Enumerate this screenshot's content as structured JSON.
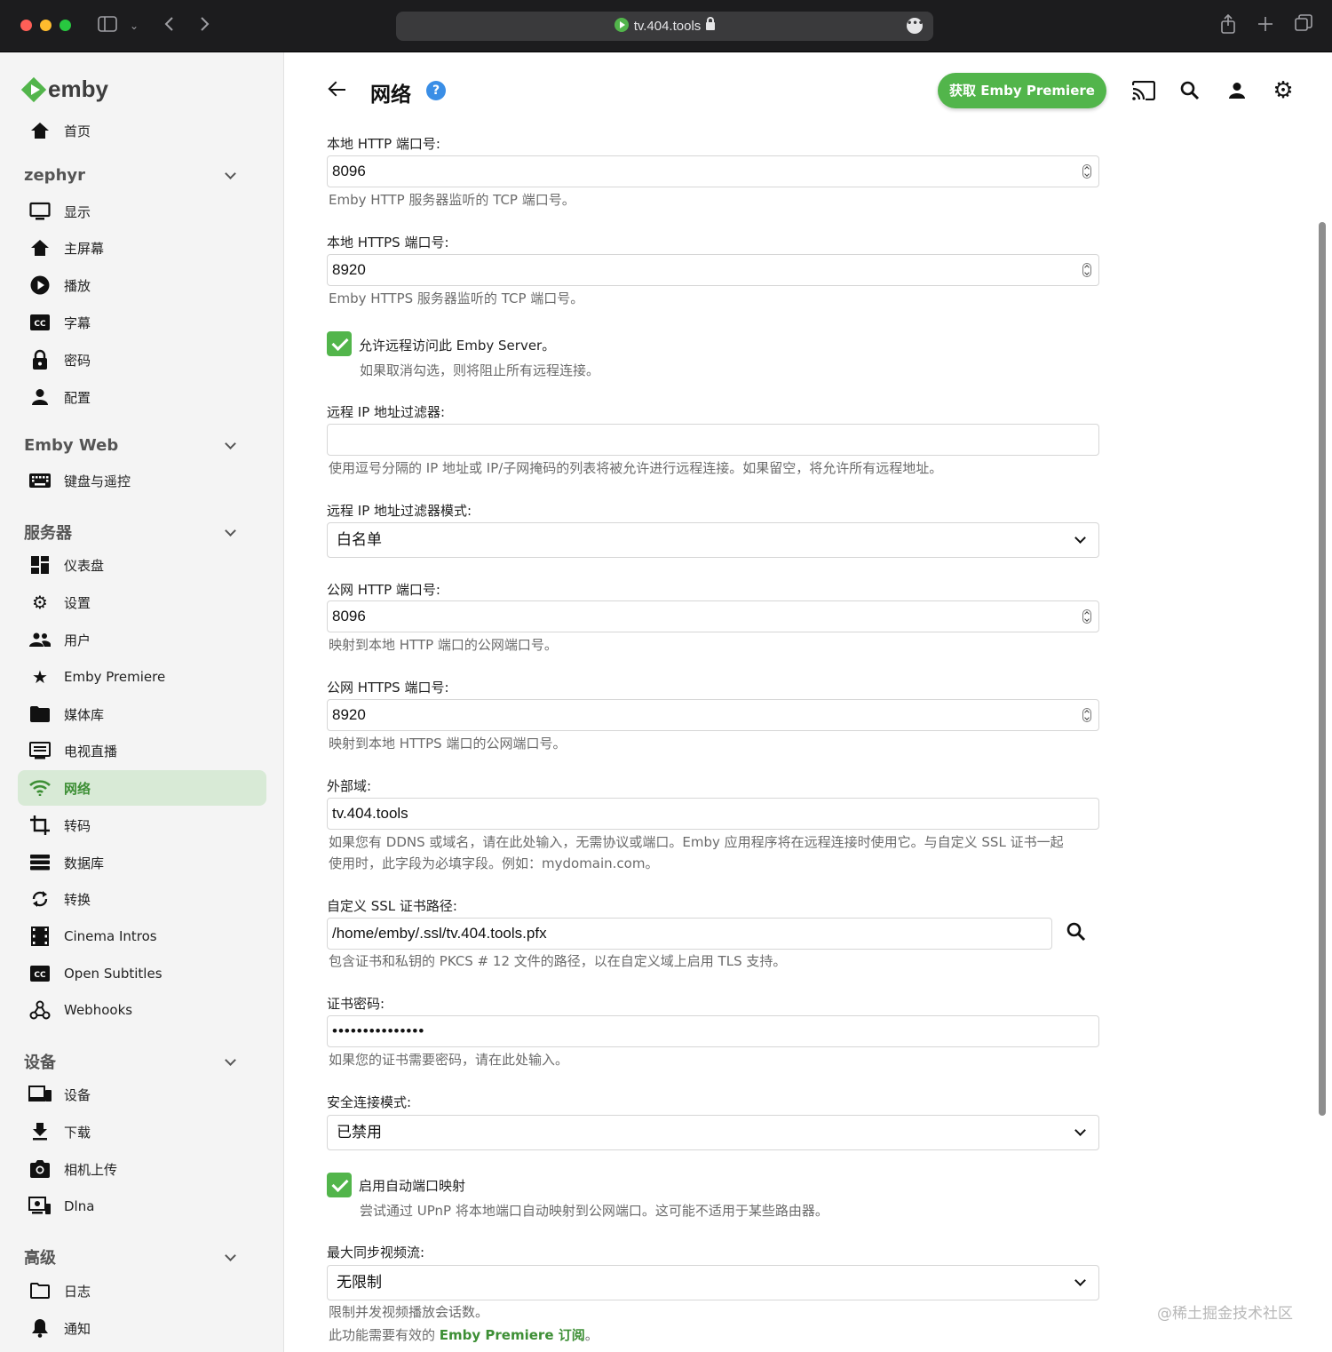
{
  "browser": {
    "url": "tv.404.tools"
  },
  "sidebar": {
    "logo_text": "emby",
    "home": "首页",
    "sections": [
      {
        "title": "zephyr",
        "items": [
          "显示",
          "主屏幕",
          "播放",
          "字幕",
          "密码",
          "配置"
        ]
      },
      {
        "title": "Emby Web",
        "items": [
          "键盘与遥控"
        ]
      },
      {
        "title": "服务器",
        "items": [
          "仪表盘",
          "设置",
          "用户",
          "Emby Premiere",
          "媒体库",
          "电视直播",
          "网络",
          "转码",
          "数据库",
          "转换",
          "Cinema Intros",
          "Open Subtitles",
          "Webhooks"
        ]
      },
      {
        "title": "设备",
        "items": [
          "设备",
          "下载",
          "相机上传",
          "Dlna"
        ]
      },
      {
        "title": "高级",
        "items": [
          "日志",
          "通知"
        ]
      }
    ],
    "active_item": "网络"
  },
  "header": {
    "title": "网络",
    "help_icon": "?",
    "premiere_button": "获取 Emby Premiere"
  },
  "form": {
    "local_http": {
      "label": "本地 HTTP 端口号:",
      "value": "8096",
      "help": "Emby HTTP 服务器监听的 TCP 端口号。"
    },
    "local_https": {
      "label": "本地 HTTPS 端口号:",
      "value": "8920",
      "help": "Emby HTTPS 服务器监听的 TCP 端口号。"
    },
    "allow_remote": {
      "label": "允许远程访问此 Emby Server。",
      "help": "如果取消勾选，则将阻止所有远程连接。",
      "checked": true
    },
    "remote_ip_filter": {
      "label": "远程 IP 地址过滤器:",
      "value": "",
      "help": "使用逗号分隔的 IP 地址或 IP/子网掩码的列表将被允许进行远程连接。如果留空，将允许所有远程地址。"
    },
    "remote_ip_filter_mode": {
      "label": "远程 IP 地址过滤器模式:",
      "value": "白名单"
    },
    "public_http": {
      "label": "公网 HTTP 端口号:",
      "value": "8096",
      "help": "映射到本地 HTTP 端口的公网端口号。"
    },
    "public_https": {
      "label": "公网 HTTPS 端口号:",
      "value": "8920",
      "help": "映射到本地 HTTPS 端口的公网端口号。"
    },
    "external_domain": {
      "label": "外部域:",
      "value": "tv.404.tools",
      "help_line1": "如果您有 DDNS 或域名，请在此处输入，无需协议或端口。Emby 应用程序将在远程连接时使用它。与自定义 SSL 证书一起",
      "help_line2": "使用时，此字段为必填字段。例如：mydomain.com。"
    },
    "ssl_cert_path": {
      "label": "自定义 SSL 证书路径:",
      "value": "/home/emby/.ssl/tv.404.tools.pfx",
      "help": "包含证书和私钥的 PKCS # 12 文件的路径，以在自定义域上启用 TLS 支持。"
    },
    "cert_password": {
      "label": "证书密码:",
      "value": "•••••••••••••••",
      "help": "如果您的证书需要密码，请在此处输入。"
    },
    "secure_mode": {
      "label": "安全连接模式:",
      "value": "已禁用"
    },
    "upnp": {
      "label": "启用自动端口映射",
      "help": "尝试通过 UPnP 将本地端口自动映射到公网端口。这可能不适用于某些路由器。",
      "checked": true
    },
    "max_streams": {
      "label": "最大同步视频流:",
      "value": "无限制",
      "help": "限制并发视频播放会话数。",
      "note_prefix": "此功能需要有效的",
      "note_link": "Emby Premiere 订阅",
      "note_suffix": "。"
    }
  },
  "watermark": "@稀土掘金技术社区",
  "colors": {
    "accent": "#52b54b",
    "active_bg": "#d8ead6",
    "help_blue": "#3a8ee6"
  }
}
